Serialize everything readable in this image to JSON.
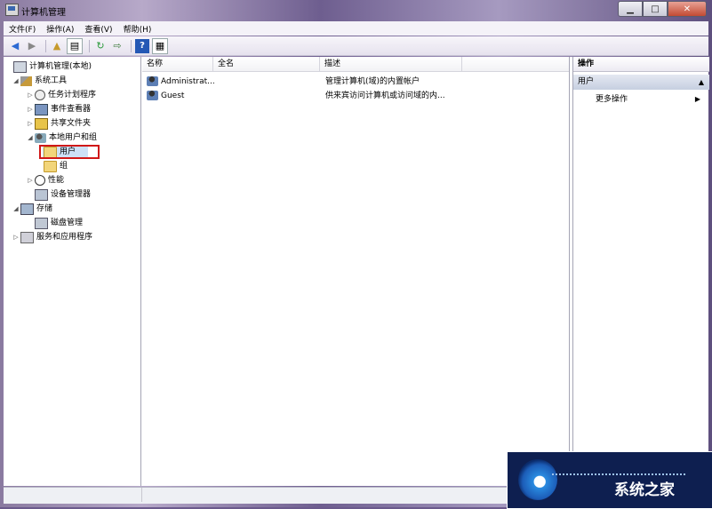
{
  "window": {
    "title": "计算机管理"
  },
  "menu": [
    "文件(F)",
    "操作(A)",
    "查看(V)",
    "帮助(H)"
  ],
  "toolbar": [
    {
      "icon": "back-arrow-icon"
    },
    {
      "icon": "forward-arrow-icon"
    },
    {
      "icon": "up-folder-icon"
    },
    {
      "icon": "show-hide-tree-icon"
    },
    {
      "icon": "refresh-icon"
    },
    {
      "icon": "export-list-icon"
    },
    {
      "icon": "help-icon"
    },
    {
      "icon": "properties-icon"
    }
  ],
  "tree": {
    "root": "计算机管理(本地)",
    "system_tools": "系统工具",
    "task_scheduler": "任务计划程序",
    "event_viewer": "事件查看器",
    "shared_folders": "共享文件夹",
    "local_users_groups": "本地用户和组",
    "users": "用户",
    "groups": "组",
    "performance": "性能",
    "device_manager": "设备管理器",
    "storage": "存储",
    "disk_management": "磁盘管理",
    "services_apps": "服务和应用程序"
  },
  "list": {
    "columns": [
      "名称",
      "全名",
      "描述"
    ],
    "rows": [
      {
        "name": "Administrat...",
        "fullname": "",
        "desc": "管理计算机(域)的内置帐户"
      },
      {
        "name": "Guest",
        "fullname": "",
        "desc": "供来宾访问计算机或访问域的内..."
      }
    ]
  },
  "actions": {
    "header": "操作",
    "section": "用户",
    "more": "更多操作"
  },
  "watermark": {
    "text": "系统之家"
  }
}
